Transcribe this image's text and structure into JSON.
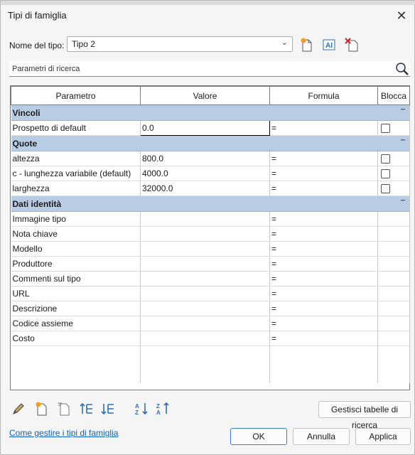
{
  "window": {
    "title": "Tipi di famiglia"
  },
  "type_row": {
    "label": "Nome del tipo:",
    "selected": "Tipo 2"
  },
  "search": {
    "placeholder": "Parametri di ricerca"
  },
  "table": {
    "headers": [
      "Parametro",
      "Valore",
      "Formula",
      "Blocca"
    ],
    "groups": [
      {
        "name": "Vincoli",
        "rows": [
          {
            "param": "Prospetto di default",
            "value": "0.0",
            "formula": "=",
            "lock": true
          }
        ]
      },
      {
        "name": "Quote",
        "rows": [
          {
            "param": "altezza",
            "value": "800.0",
            "formula": "=",
            "lock": true
          },
          {
            "param": "c - lunghezza variabile (default)",
            "value": "4000.0",
            "formula": "=",
            "lock": true
          },
          {
            "param": "larghezza",
            "value": "32000.0",
            "formula": "=",
            "lock": true
          }
        ]
      },
      {
        "name": "Dati identità",
        "rows": [
          {
            "param": "Immagine tipo",
            "value": "",
            "formula": "=",
            "lock": false
          },
          {
            "param": "Nota chiave",
            "value": "",
            "formula": "=",
            "lock": false
          },
          {
            "param": "Modello",
            "value": "",
            "formula": "=",
            "lock": false
          },
          {
            "param": "Produttore",
            "value": "",
            "formula": "=",
            "lock": false
          },
          {
            "param": "Commenti sul tipo",
            "value": "",
            "formula": "=",
            "lock": false
          },
          {
            "param": "URL",
            "value": "",
            "formula": "=",
            "lock": false
          },
          {
            "param": "Descrizione",
            "value": "",
            "formula": "=",
            "lock": false
          },
          {
            "param": "Codice assieme",
            "value": "",
            "formula": "=",
            "lock": false
          },
          {
            "param": "Costo",
            "value": "",
            "formula": "=",
            "lock": false
          }
        ]
      }
    ]
  },
  "buttons": {
    "manage_lookup": "Gestisci tabelle di ricerca",
    "ok": "OK",
    "cancel": "Annulla",
    "apply": "Applica"
  },
  "help_link": "Come gestire i tipi di famiglia",
  "colors": {
    "group_header": "#b8cde4",
    "link": "#0b63c7",
    "ok_border": "#3c7bd4"
  }
}
